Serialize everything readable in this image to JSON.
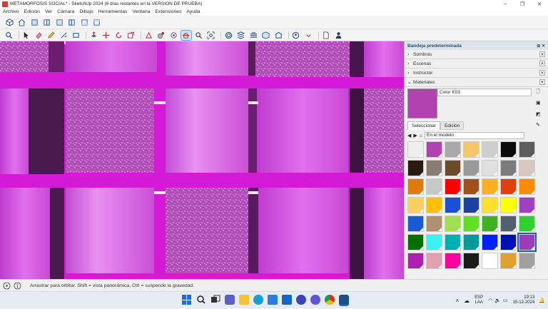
{
  "window": {
    "title": "METAMORFOSIS SOCIAL* - SketchUp 2024 (6 días restantes en la VERSIÓN DE PRUEBA)",
    "minimize": "–",
    "maximize": "❐",
    "close": "✕"
  },
  "menu": [
    "Archivo",
    "Edición",
    "Ver",
    "Cámara",
    "Dibujo",
    "Herramientas",
    "Ventana",
    "Extensiones",
    "Ayuda"
  ],
  "toolbar1_icons": [
    "cube-iso-icon",
    "house-icon",
    "cube-front-icon",
    "cube-right-icon",
    "cube-back-icon",
    "cube-left-icon",
    "cube-bottom-icon",
    "cube-top-icon"
  ],
  "toolbar2_icons": [
    "search-icon",
    "select-arrow-icon",
    "eraser-icon",
    "pencil-icon",
    "line-tool-icon",
    "rectangle-tool-icon",
    "push-pull-icon",
    "move-icon",
    "rotate-icon",
    "scale-icon",
    "tape-measure-icon",
    "paint-bucket-icon",
    "orbit-icon",
    "pan-icon",
    "zoom-icon",
    "zoom-extents-icon",
    "section-icon",
    "layers-icon",
    "styles-icon",
    "components-icon",
    "warehouse-icon",
    "extension-icon",
    "document-icon",
    "person-icon"
  ],
  "status": {
    "text": "Arrastrar para orbitar. Shift = vista panorámica, Ctrl = suspende la gravedad."
  },
  "panel": {
    "title": "Bandeja predeterminada",
    "sections": [
      {
        "label": "Sombras"
      },
      {
        "label": "Escenas"
      },
      {
        "label": "Instructor"
      },
      {
        "label": "Materiales"
      }
    ],
    "material_name": "Color K03",
    "tabs": [
      "Seleccionar",
      "Edición"
    ],
    "library_select": "En el modelo",
    "swatch_colors": [
      "#eeeeee",
      "#b043b0",
      "#a9a9a9",
      "#f4c86a",
      "#cfcfcf",
      "#0b0b0b",
      "#5d5d5d",
      "#2a1a10",
      "#8a7c72",
      "#6a4a2a",
      "#9a9a9a",
      "#e0e0e0",
      "#7c7c7c",
      "#d8c6c0",
      "#e07a10",
      "#c8c8c8",
      "#ff0000",
      "#a0501a",
      "#ffb020",
      "#e04010",
      "#ff8c00",
      "#f8d060",
      "#ffc000",
      "#1a4fd6",
      "#2040a0",
      "#ffe030",
      "#ffff00",
      "#a040c0",
      "#1a5ad8",
      "#b09070",
      "#a0e050",
      "#60e020",
      "#40b020",
      "#506070",
      "#30d030",
      "#007000",
      "#40f0f0",
      "#00b0b0",
      "#009a9a",
      "#0020ff",
      "#0010b0",
      "#9c3db8",
      "#b020b0",
      "#e0a0b0",
      "#ff00a0",
      "#1a1a1a",
      "#ffffff",
      "#e0a030",
      "#a0a0a0"
    ]
  },
  "taskbar": {
    "lang": "ESP",
    "region": "LAA",
    "time": "19:13",
    "date": "15-12-2024"
  }
}
